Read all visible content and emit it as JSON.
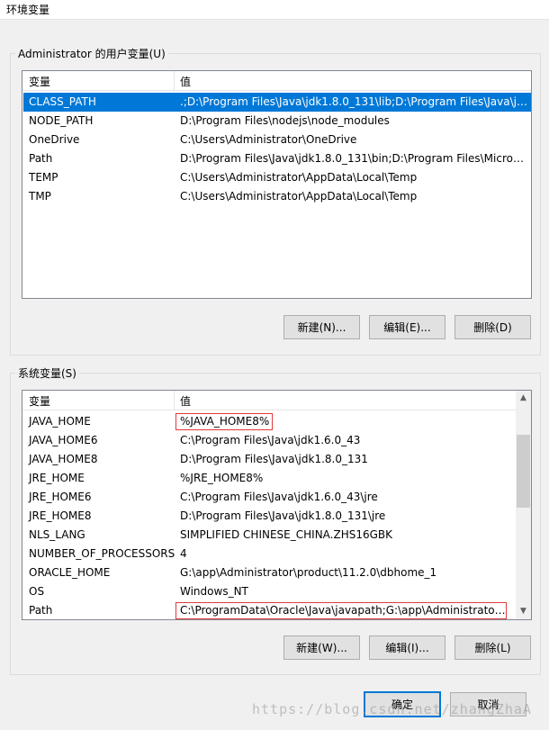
{
  "window": {
    "title": "环境变量"
  },
  "user_vars": {
    "group_label": "Administrator 的用户变量(U)",
    "col_name": "变量",
    "col_value": "值",
    "rows": [
      {
        "name": "CLASS_PATH",
        "value": ".;D:\\Program Files\\Java\\jdk1.8.0_131\\lib;D:\\Program Files\\Java\\jd...",
        "selected": true
      },
      {
        "name": "NODE_PATH",
        "value": "D:\\Program Files\\nodejs\\node_modules"
      },
      {
        "name": "OneDrive",
        "value": "C:\\Users\\Administrator\\OneDrive"
      },
      {
        "name": "Path",
        "value": "D:\\Program Files\\Java\\jdk1.8.0_131\\bin;D:\\Program Files\\Micros..."
      },
      {
        "name": "TEMP",
        "value": "C:\\Users\\Administrator\\AppData\\Local\\Temp"
      },
      {
        "name": "TMP",
        "value": "C:\\Users\\Administrator\\AppData\\Local\\Temp"
      }
    ],
    "buttons": {
      "new": "新建(N)...",
      "edit": "编辑(E)...",
      "delete": "删除(D)"
    }
  },
  "system_vars": {
    "group_label": "系统变量(S)",
    "col_name": "变量",
    "col_value": "值",
    "rows": [
      {
        "name": "JAVA_HOME",
        "value": "%JAVA_HOME8%",
        "highlighted": true
      },
      {
        "name": "JAVA_HOME6",
        "value": "C:\\Program Files\\Java\\jdk1.6.0_43"
      },
      {
        "name": "JAVA_HOME8",
        "value": "D:\\Program Files\\Java\\jdk1.8.0_131"
      },
      {
        "name": "JRE_HOME",
        "value": "%JRE_HOME8%"
      },
      {
        "name": "JRE_HOME6",
        "value": "C:\\Program Files\\Java\\jdk1.6.0_43\\jre"
      },
      {
        "name": "JRE_HOME8",
        "value": "D:\\Program Files\\Java\\jdk1.8.0_131\\jre"
      },
      {
        "name": "NLS_LANG",
        "value": "SIMPLIFIED CHINESE_CHINA.ZHS16GBK"
      },
      {
        "name": "NUMBER_OF_PROCESSORS",
        "value": "4"
      },
      {
        "name": "ORACLE_HOME",
        "value": "G:\\app\\Administrator\\product\\11.2.0\\dbhome_1"
      },
      {
        "name": "OS",
        "value": "Windows_NT"
      },
      {
        "name": "Path",
        "value": "C:\\ProgramData\\Oracle\\Java\\javapath;G:\\app\\Administrator\\...",
        "highlighted": true
      }
    ],
    "buttons": {
      "new": "新建(W)...",
      "edit": "编辑(I)...",
      "delete": "删除(L)"
    }
  },
  "footer": {
    "ok": "确定",
    "cancel": "取消"
  },
  "watermark": "https://blog.csdn.net/zhangZhaA",
  "colors": {
    "selection": "#0078d7",
    "highlight_box": "#e03a3a",
    "primary_button_border": "#0078d7"
  },
  "icons": {
    "scroll_up": "chevron-up-icon",
    "scroll_down": "chevron-down-icon"
  }
}
